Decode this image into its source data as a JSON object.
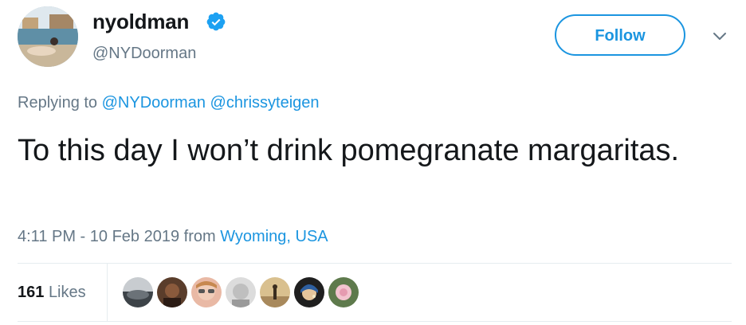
{
  "user": {
    "display_name": "nyoldman",
    "handle": "@NYDoorman",
    "verified": true,
    "verified_icon": "verified-badge-icon",
    "avatar_icon": "profile-avatar"
  },
  "follow_button": {
    "label": "Follow"
  },
  "menu": {
    "icon": "chevron-down-icon"
  },
  "reply_context": {
    "prefix": "Replying to",
    "mentions": [
      "@NYDoorman",
      "@chrissyteigen"
    ]
  },
  "tweet": {
    "text": "To this day I won’t drink pomegranate margaritas."
  },
  "meta": {
    "timestamp": "4:11 PM - 10 Feb 2019",
    "from_label": "from",
    "location": "Wyoming, USA"
  },
  "stats": {
    "likes_count": "161",
    "likes_label": "Likes",
    "liker_count_shown": 7
  },
  "colors": {
    "accent": "#1b95e0",
    "text_primary": "#14171a",
    "text_secondary": "#657786",
    "divider": "#e6ecf0"
  }
}
